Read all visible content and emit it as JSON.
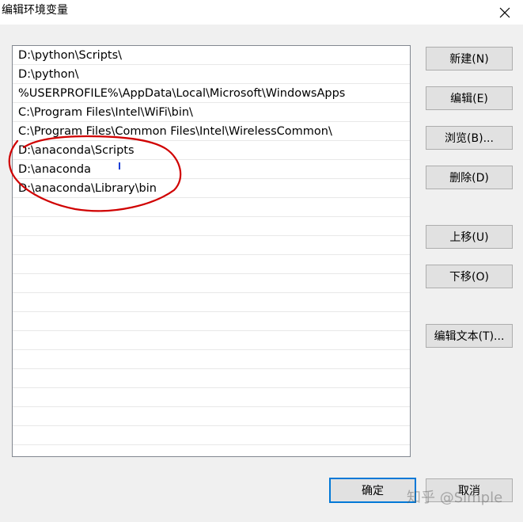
{
  "window": {
    "title": "编辑环境变量",
    "close_icon": "close-icon"
  },
  "paths": [
    "D:\\python\\Scripts\\",
    "D:\\python\\",
    "%USERPROFILE%\\AppData\\Local\\Microsoft\\WindowsApps",
    "C:\\Program Files\\Intel\\WiFi\\bin\\",
    "C:\\Program Files\\Common Files\\Intel\\WirelessCommon\\",
    "D:\\anaconda\\Scripts",
    "D:\\anaconda",
    "D:\\anaconda\\Library\\bin"
  ],
  "buttons": {
    "new": "新建(N)",
    "edit": "编辑(E)",
    "browse": "浏览(B)...",
    "delete": "删除(D)",
    "move_up": "上移(U)",
    "move_down": "下移(O)",
    "edit_text": "编辑文本(T)...",
    "ok": "确定",
    "cancel": "取消"
  },
  "watermark": "知乎 @Simple",
  "colors": {
    "annotation": "#d00000",
    "focus": "#0078d7"
  }
}
